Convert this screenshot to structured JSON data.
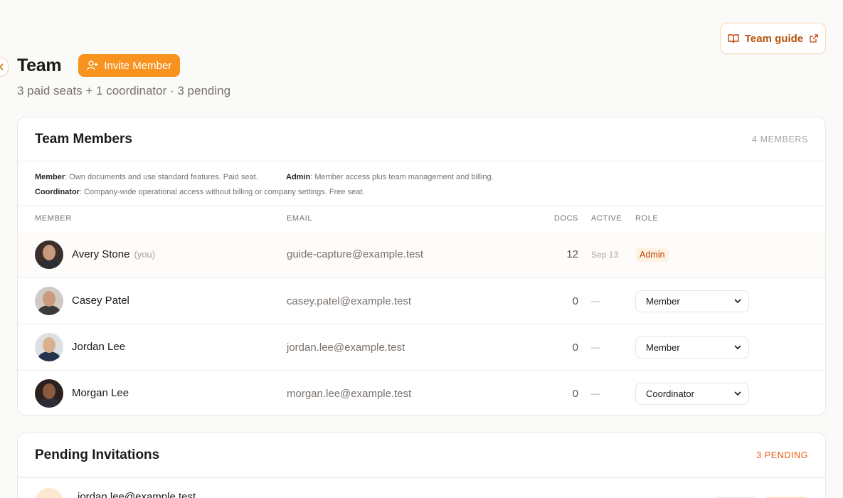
{
  "header": {
    "title": "Team",
    "invite_label": "Invite Member",
    "subtitle": "3 paid seats + 1 coordinator · 3 pending",
    "guide_label": "Team guide"
  },
  "members_card": {
    "title": "Team Members",
    "count": "4 MEMBERS",
    "legend": {
      "member_term": "Member",
      "member_desc": ": Own documents and use standard features. Paid seat.",
      "admin_term": "Admin",
      "admin_desc": ": Member access plus team management and billing.",
      "coordinator_term": "Coordinator",
      "coordinator_desc": ": Company-wide operational access without billing or company settings. Free seat."
    },
    "columns": [
      "MEMBER",
      "EMAIL",
      "DOCS",
      "ACTIVE",
      "ROLE"
    ],
    "rows": [
      {
        "name": "Avery Stone",
        "you": "(you)",
        "email": "guide-capture@example.test",
        "docs": "12",
        "active": "Sep 13",
        "role": "Admin"
      },
      {
        "name": "Casey Patel",
        "you": "",
        "email": "casey.patel@example.test",
        "docs": "0",
        "active": "—",
        "role": "Member"
      },
      {
        "name": "Jordan Lee",
        "you": "",
        "email": "jordan.lee@example.test",
        "docs": "0",
        "active": "—",
        "role": "Member"
      },
      {
        "name": "Morgan Lee",
        "you": "",
        "email": "morgan.lee@example.test",
        "docs": "0",
        "active": "—",
        "role": "Coordinator"
      }
    ]
  },
  "pending_card": {
    "title": "Pending Invitations",
    "count": "3 PENDING",
    "rows": [
      {
        "email": "jordan.lee@example.test"
      }
    ]
  },
  "colors": {
    "accent": "#f7931e",
    "accent_text": "#c2410c",
    "badge_bg": "#fef3e2"
  },
  "icons": [
    "chevron-left-icon",
    "book-open-icon",
    "external-link-icon",
    "user-plus-icon",
    "chevron-down-icon"
  ]
}
